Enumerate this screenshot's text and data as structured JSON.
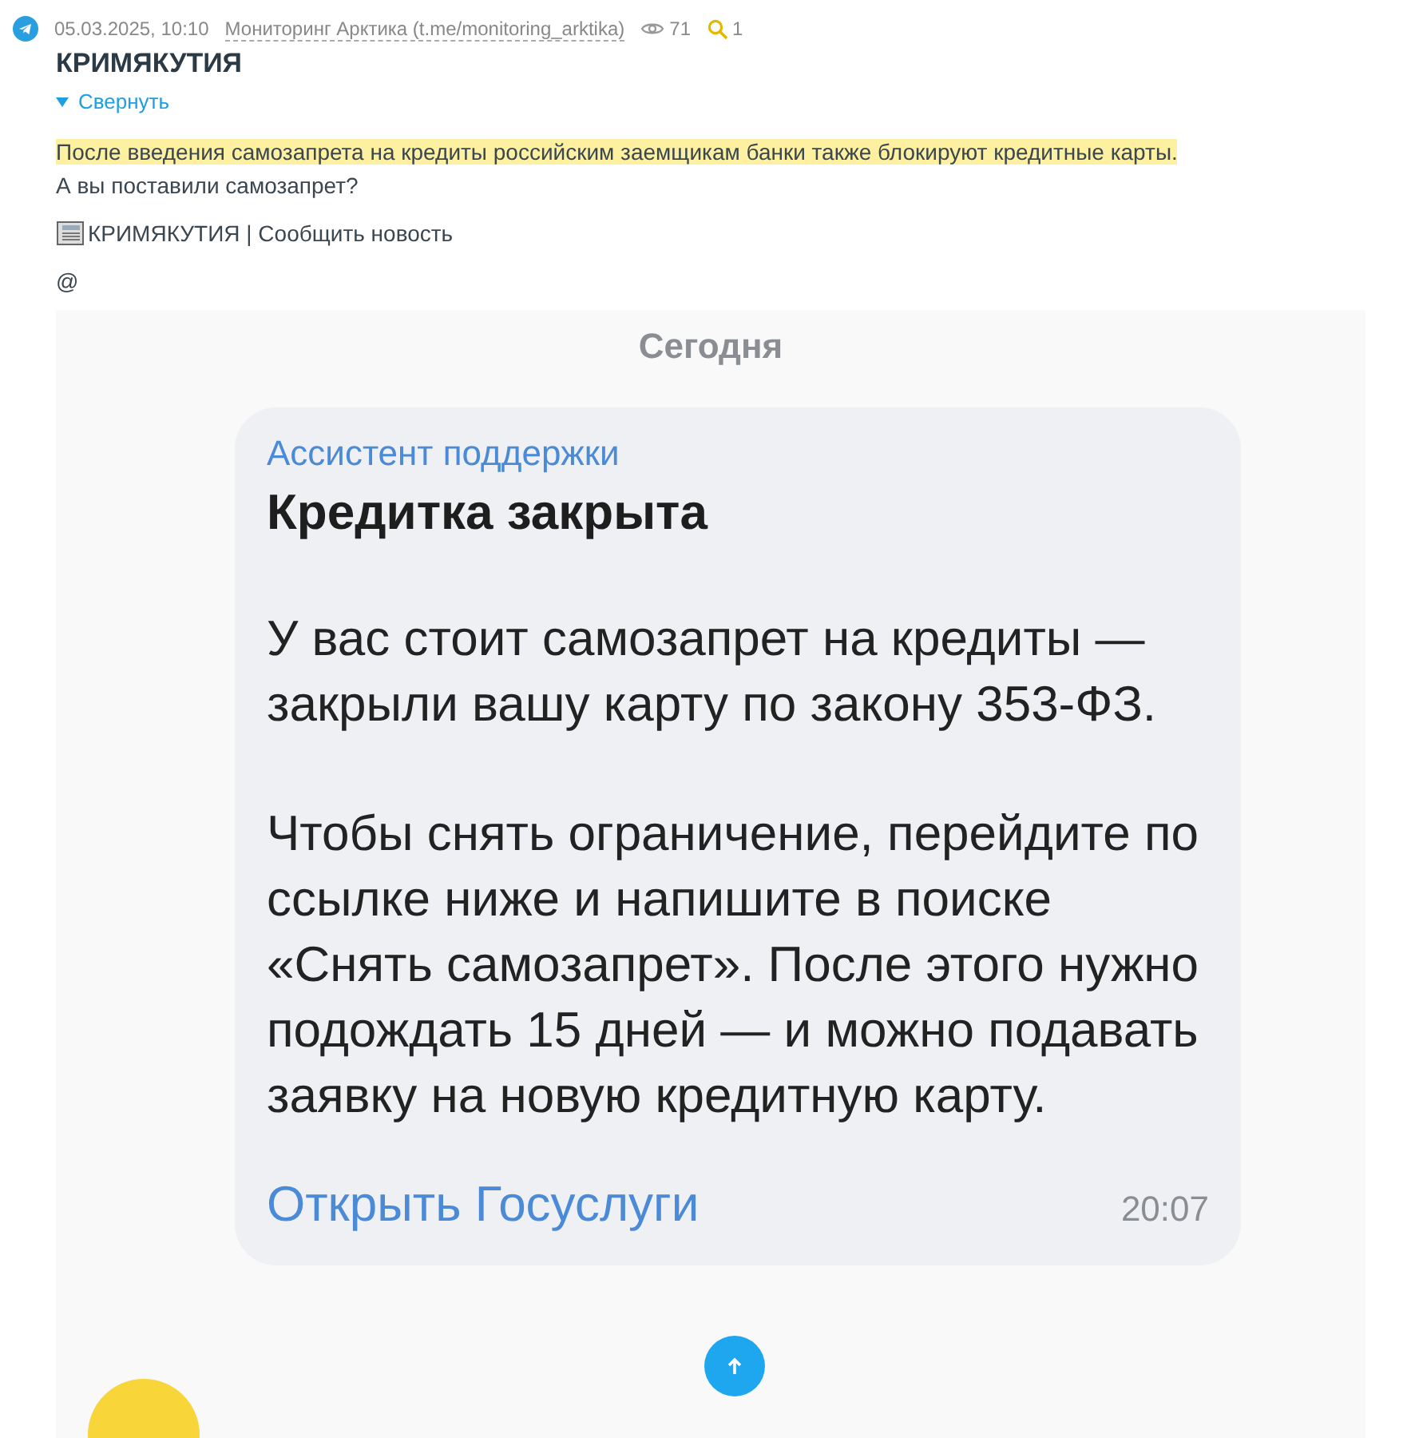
{
  "post": {
    "date": "05.03.2025, 10:10",
    "source": "Мониторинг Арктика (t.me/monitoring_arktika)",
    "views": "71",
    "finds": "1",
    "title": "КРИМЯКУТИЯ",
    "collapse": {
      "label": "Свернуть",
      "expanded": true
    },
    "highlighted_text": "После введения самозапрета на кредиты российским заемщикам банки также блокируют кредитные карты.",
    "text": "А вы поставили самозапрет?",
    "footer": "КРИМЯКУТИЯ | Сообщить новость",
    "mention": "@"
  },
  "screenshot": {
    "day_label": "Сегодня",
    "message": {
      "sender": "Ассистент поддержки",
      "title": "Кредитка закрыта",
      "paragraphs": [
        "У вас стоит самозапрет на кредиты — закрыли вашу карту по закону 353-ФЗ.",
        "Чтобы снять ограничение, перейдите по ссылке ниже и напишите в поиске «Снять самозапрет». После этого нужно подождать 15 дней — и можно подавать заявку на новую кредитную карту."
      ],
      "link": "Открыть Госуслуги",
      "time": "20:07"
    }
  }
}
